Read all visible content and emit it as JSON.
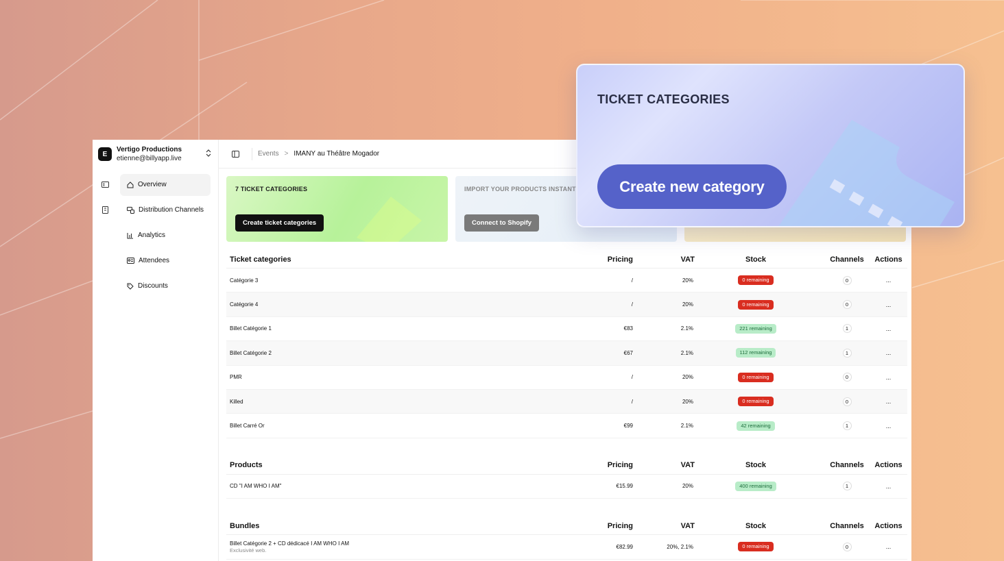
{
  "account": {
    "initial": "E",
    "name": "Vertigo Productions",
    "email": "etienne@billyapp.live"
  },
  "nav": [
    {
      "label": "Overview",
      "icon": "home-icon",
      "active": true
    },
    {
      "label": "Distribution Channels",
      "icon": "channels-icon",
      "active": false
    },
    {
      "label": "Analytics",
      "icon": "analytics-icon",
      "active": false
    },
    {
      "label": "Attendees",
      "icon": "attendees-icon",
      "active": false
    },
    {
      "label": "Discounts",
      "icon": "tag-icon",
      "active": false
    }
  ],
  "breadcrumb": {
    "parent": "Events",
    "separator": ">",
    "current": "IMANY au Théâtre Mogador"
  },
  "cards": {
    "tickets": {
      "title": "7 TICKET CATEGORIES",
      "button": "Create ticket categories"
    },
    "import": {
      "title": "IMPORT YOUR PRODUCTS INSTANT",
      "button": "Connect to Shopify"
    }
  },
  "columns": {
    "pricing": "Pricing",
    "vat": "VAT",
    "stock": "Stock",
    "channels": "Channels",
    "actions": "Actions"
  },
  "ticket_section": {
    "title": "Ticket categories",
    "rows": [
      {
        "name": "Catégorie 3",
        "price": "/",
        "vat": "20%",
        "stock": "0 remaining",
        "stock_status": "red",
        "channels": "0",
        "actions": "..."
      },
      {
        "name": "Catégorie 4",
        "price": "/",
        "vat": "20%",
        "stock": "0 remaining",
        "stock_status": "red",
        "channels": "0",
        "actions": "..."
      },
      {
        "name": "Billet Catégorie 1",
        "price": "€83",
        "vat": "2.1%",
        "stock": "221 remaining",
        "stock_status": "green",
        "channels": "1",
        "actions": "..."
      },
      {
        "name": "Billet Catégorie 2",
        "price": "€67",
        "vat": "2.1%",
        "stock": "112 remaining",
        "stock_status": "green",
        "channels": "1",
        "actions": "..."
      },
      {
        "name": "PMR",
        "price": "/",
        "vat": "20%",
        "stock": "0 remaining",
        "stock_status": "red",
        "channels": "0",
        "actions": "..."
      },
      {
        "name": "Killed",
        "price": "/",
        "vat": "20%",
        "stock": "0 remaining",
        "stock_status": "red",
        "channels": "0",
        "actions": "..."
      },
      {
        "name": "Billet Carré Or",
        "price": "€99",
        "vat": "2.1%",
        "stock": "42 remaining",
        "stock_status": "green",
        "channels": "1",
        "actions": "..."
      }
    ]
  },
  "product_section": {
    "title": "Products",
    "rows": [
      {
        "name": "CD \"I AM WHO I AM\"",
        "price": "€15.99",
        "vat": "20%",
        "stock": "400 remaining",
        "stock_status": "green",
        "channels": "1",
        "actions": "..."
      }
    ]
  },
  "bundle_section": {
    "title": "Bundles",
    "rows": [
      {
        "name": "Billet Catégorie 2 + CD dédicacé I AM WHO I AM",
        "sub": "Exclusivité web.",
        "price": "€82.99",
        "vat": "20%, 2.1%",
        "stock": "0 remaining",
        "stock_status": "red",
        "channels": "0",
        "actions": "..."
      }
    ]
  },
  "floating_card": {
    "title": "TICKET CATEGORIES",
    "button": "Create new category"
  },
  "colors": {
    "accent": "#5562c9",
    "badge_red": "#d92d20",
    "badge_green": "#b8ecc8"
  }
}
